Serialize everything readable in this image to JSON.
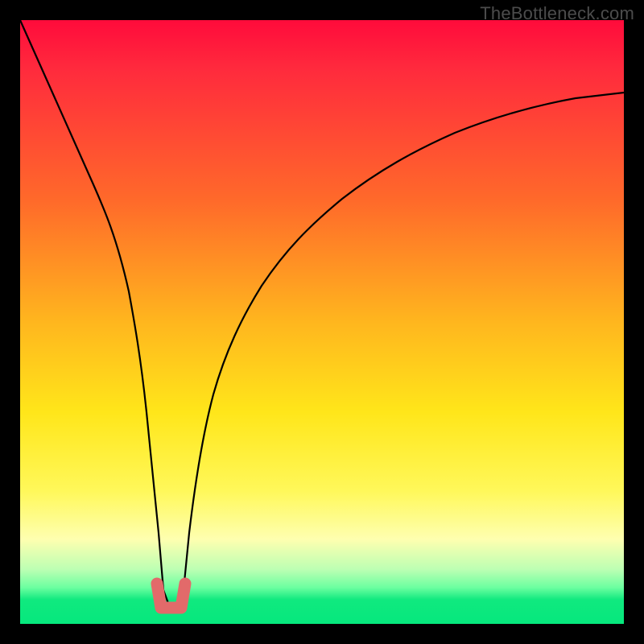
{
  "watermark": {
    "text": "TheBottleneck.com"
  },
  "chart_data": {
    "type": "line",
    "title": "",
    "xlabel": "",
    "ylabel": "",
    "xlim": [
      0,
      100
    ],
    "ylim": [
      0,
      100
    ],
    "series": [
      {
        "name": "bottleneck-curve",
        "x": [
          0,
          2,
          4,
          6,
          8,
          10,
          12,
          14,
          16,
          17.5,
          19,
          20,
          21,
          22,
          23,
          24,
          26,
          28,
          30,
          33,
          36,
          40,
          45,
          50,
          56,
          62,
          70,
          78,
          86,
          93,
          100
        ],
        "values": [
          100,
          91,
          82,
          73,
          64,
          55,
          45,
          35,
          24,
          14,
          6,
          2,
          2,
          2,
          6,
          14,
          27,
          36,
          43,
          51,
          57,
          64,
          70,
          74,
          78,
          81,
          84,
          86,
          87.5,
          88.3,
          89
        ]
      },
      {
        "name": "highlight-u",
        "color": "#e26a6a",
        "x": [
          19,
          20,
          20.5,
          21,
          21.5,
          22,
          23
        ],
        "values": [
          6,
          2,
          1.7,
          1.7,
          1.7,
          2,
          6
        ]
      }
    ],
    "background_gradient": {
      "top": "#ff0b3b",
      "mid_upper": "#ff6a2a",
      "mid": "#ffe61a",
      "mid_lower": "#feffb0",
      "bottom": "#06e87d"
    }
  }
}
